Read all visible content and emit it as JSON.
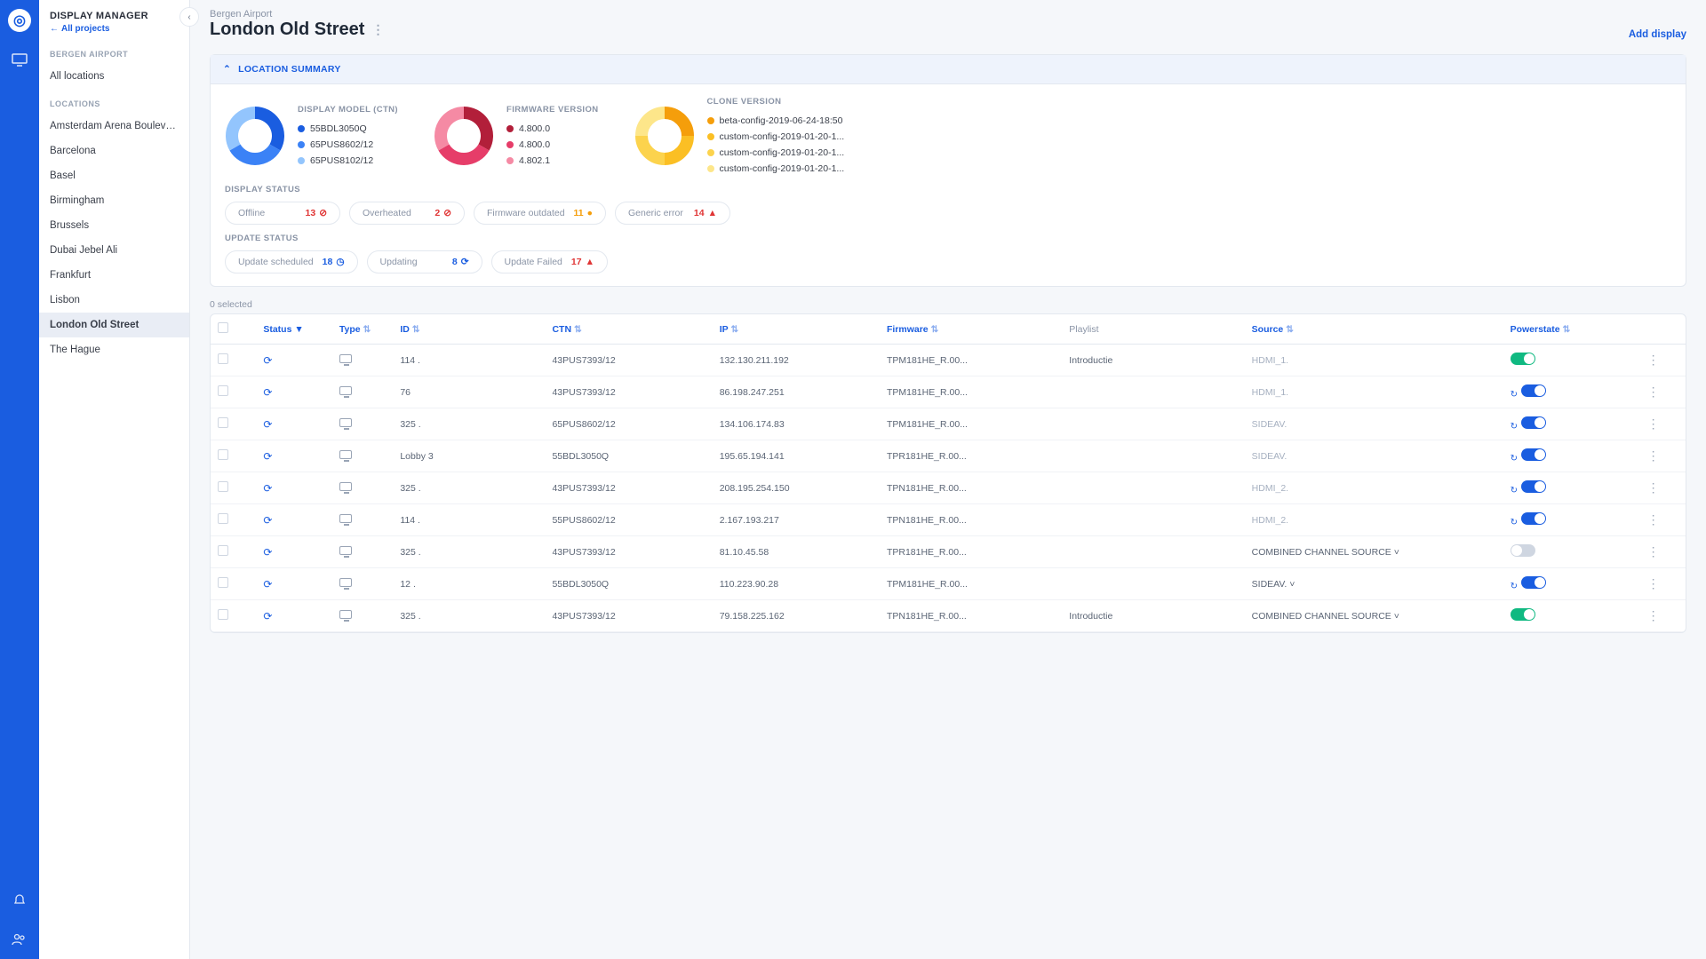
{
  "app": {
    "title": "DISPLAY MANAGER",
    "back_link": "All projects"
  },
  "sidebar": {
    "section_project": "BERGEN AIRPORT",
    "all_locations": "All locations",
    "section_locations": "LOCATIONS",
    "items": [
      "Amsterdam Arena Bouleva...",
      "Barcelona",
      "Basel",
      "Birmingham",
      "Brussels",
      "Dubai Jebel Ali",
      "Frankfurt",
      "Lisbon",
      "London Old Street",
      "The Hague"
    ],
    "active_index": 8
  },
  "header": {
    "breadcrumb": "Bergen Airport",
    "title": "London Old Street",
    "add_display": "Add display"
  },
  "summary": {
    "panel_title": "LOCATION SUMMARY",
    "groups": [
      {
        "title": "DISPLAY MODEL (CTN)",
        "colors": [
          "#1a5de0",
          "#3b82f6",
          "#93c5fd"
        ],
        "legend": [
          "55BDL3050Q",
          "65PUS8602/12",
          "65PUS8102/12"
        ]
      },
      {
        "title": "FIRMWARE VERSION",
        "colors": [
          "#b21f3a",
          "#e63d69",
          "#f58aa4"
        ],
        "legend": [
          "4.800.0",
          "4.800.0",
          "4.802.1"
        ]
      },
      {
        "title": "CLONE VERSION",
        "colors": [
          "#f59e0b",
          "#fbbf24",
          "#fcd34d",
          "#fde68a"
        ],
        "legend": [
          "beta-config-2019-06-24-18:50",
          "custom-config-2019-01-20-1...",
          "custom-config-2019-01-20-1...",
          "custom-config-2019-01-20-1..."
        ]
      }
    ],
    "display_status_label": "DISPLAY STATUS",
    "display_status": [
      {
        "label": "Offline",
        "value": "13",
        "icon": "⊘",
        "color": "c-red"
      },
      {
        "label": "Overheated",
        "value": "2",
        "icon": "⊘",
        "color": "c-red"
      },
      {
        "label": "Firmware outdated",
        "value": "11",
        "icon": "●",
        "color": "c-orange"
      },
      {
        "label": "Generic error",
        "value": "14",
        "icon": "▲",
        "color": "c-red"
      }
    ],
    "update_status_label": "UPDATE STATUS",
    "update_status": [
      {
        "label": "Update scheduled",
        "value": "18",
        "icon": "◷",
        "color": "c-blue"
      },
      {
        "label": "Updating",
        "value": "8",
        "icon": "⟳",
        "color": "c-blue"
      },
      {
        "label": "Update Failed",
        "value": "17",
        "icon": "▲",
        "color": "c-red"
      }
    ]
  },
  "table": {
    "selected_text": "0 selected",
    "columns": [
      "Status",
      "Type",
      "ID",
      "CTN",
      "IP",
      "Firmware",
      "Playlist",
      "Source",
      "Powerstate"
    ],
    "rows": [
      {
        "id": "114 .",
        "ctn": "43PUS7393/12",
        "ip": "132.130.211.192",
        "fw": "TPM181HE_R.00...",
        "playlist": "Introductie",
        "source": "HDMI_1.",
        "sched": false,
        "toggle": "on-green"
      },
      {
        "id": "76",
        "ctn": "43PUS7393/12",
        "ip": "86.198.247.251",
        "fw": "TPM181HE_R.00...",
        "playlist": "",
        "source": "HDMI_1.",
        "sched": true,
        "toggle": "on-blue"
      },
      {
        "id": "325 .",
        "ctn": "65PUS8602/12",
        "ip": "134.106.174.83",
        "fw": "TPM181HE_R.00...",
        "playlist": "",
        "source": "SIDEAV.",
        "sched": true,
        "toggle": "on-blue"
      },
      {
        "id": "Lobby 3",
        "ctn": "55BDL3050Q",
        "ip": "195.65.194.141",
        "fw": "TPR181HE_R.00...",
        "playlist": "",
        "source": "SIDEAV.",
        "sched": true,
        "toggle": "on-blue"
      },
      {
        "id": "325 .",
        "ctn": "43PUS7393/12",
        "ip": "208.195.254.150",
        "fw": "TPN181HE_R.00...",
        "playlist": "",
        "source": "HDMI_2.",
        "sched": true,
        "toggle": "on-blue"
      },
      {
        "id": "114 .",
        "ctn": "55PUS8602/12",
        "ip": "2.167.193.217",
        "fw": "TPN181HE_R.00...",
        "playlist": "",
        "source": "HDMI_2.",
        "sched": true,
        "toggle": "on-blue"
      },
      {
        "id": "325 .",
        "ctn": "43PUS7393/12",
        "ip": "81.10.45.58",
        "fw": "TPR181HE_R.00...",
        "playlist": "",
        "source": "COMBINED CHANNEL SOURCE ˅",
        "sched": false,
        "toggle": "off"
      },
      {
        "id": "12 .",
        "ctn": "55BDL3050Q",
        "ip": "110.223.90.28",
        "fw": "TPM181HE_R.00...",
        "playlist": "",
        "source": "SIDEAV.               ˅",
        "sched": true,
        "toggle": "on-blue"
      },
      {
        "id": "325 .",
        "ctn": "43PUS7393/12",
        "ip": "79.158.225.162",
        "fw": "TPN181HE_R.00...",
        "playlist": "Introductie",
        "source": "COMBINED CHANNEL SOURCE ˅",
        "sched": false,
        "toggle": "on-green"
      }
    ]
  },
  "chart_data": [
    {
      "type": "pie",
      "title": "DISPLAY MODEL (CTN)",
      "categories": [
        "55BDL3050Q",
        "65PUS8602/12",
        "65PUS8102/12"
      ],
      "values": [
        45,
        35,
        20
      ]
    },
    {
      "type": "pie",
      "title": "FIRMWARE VERSION",
      "categories": [
        "4.800.0",
        "4.800.0",
        "4.802.1"
      ],
      "values": [
        40,
        40,
        20
      ]
    },
    {
      "type": "pie",
      "title": "CLONE VERSION",
      "categories": [
        "beta-config-2019-06-24-18:50",
        "custom-config-2019-01-20-1...",
        "custom-config-2019-01-20-1...",
        "custom-config-2019-01-20-1..."
      ],
      "values": [
        35,
        30,
        20,
        15
      ]
    }
  ]
}
